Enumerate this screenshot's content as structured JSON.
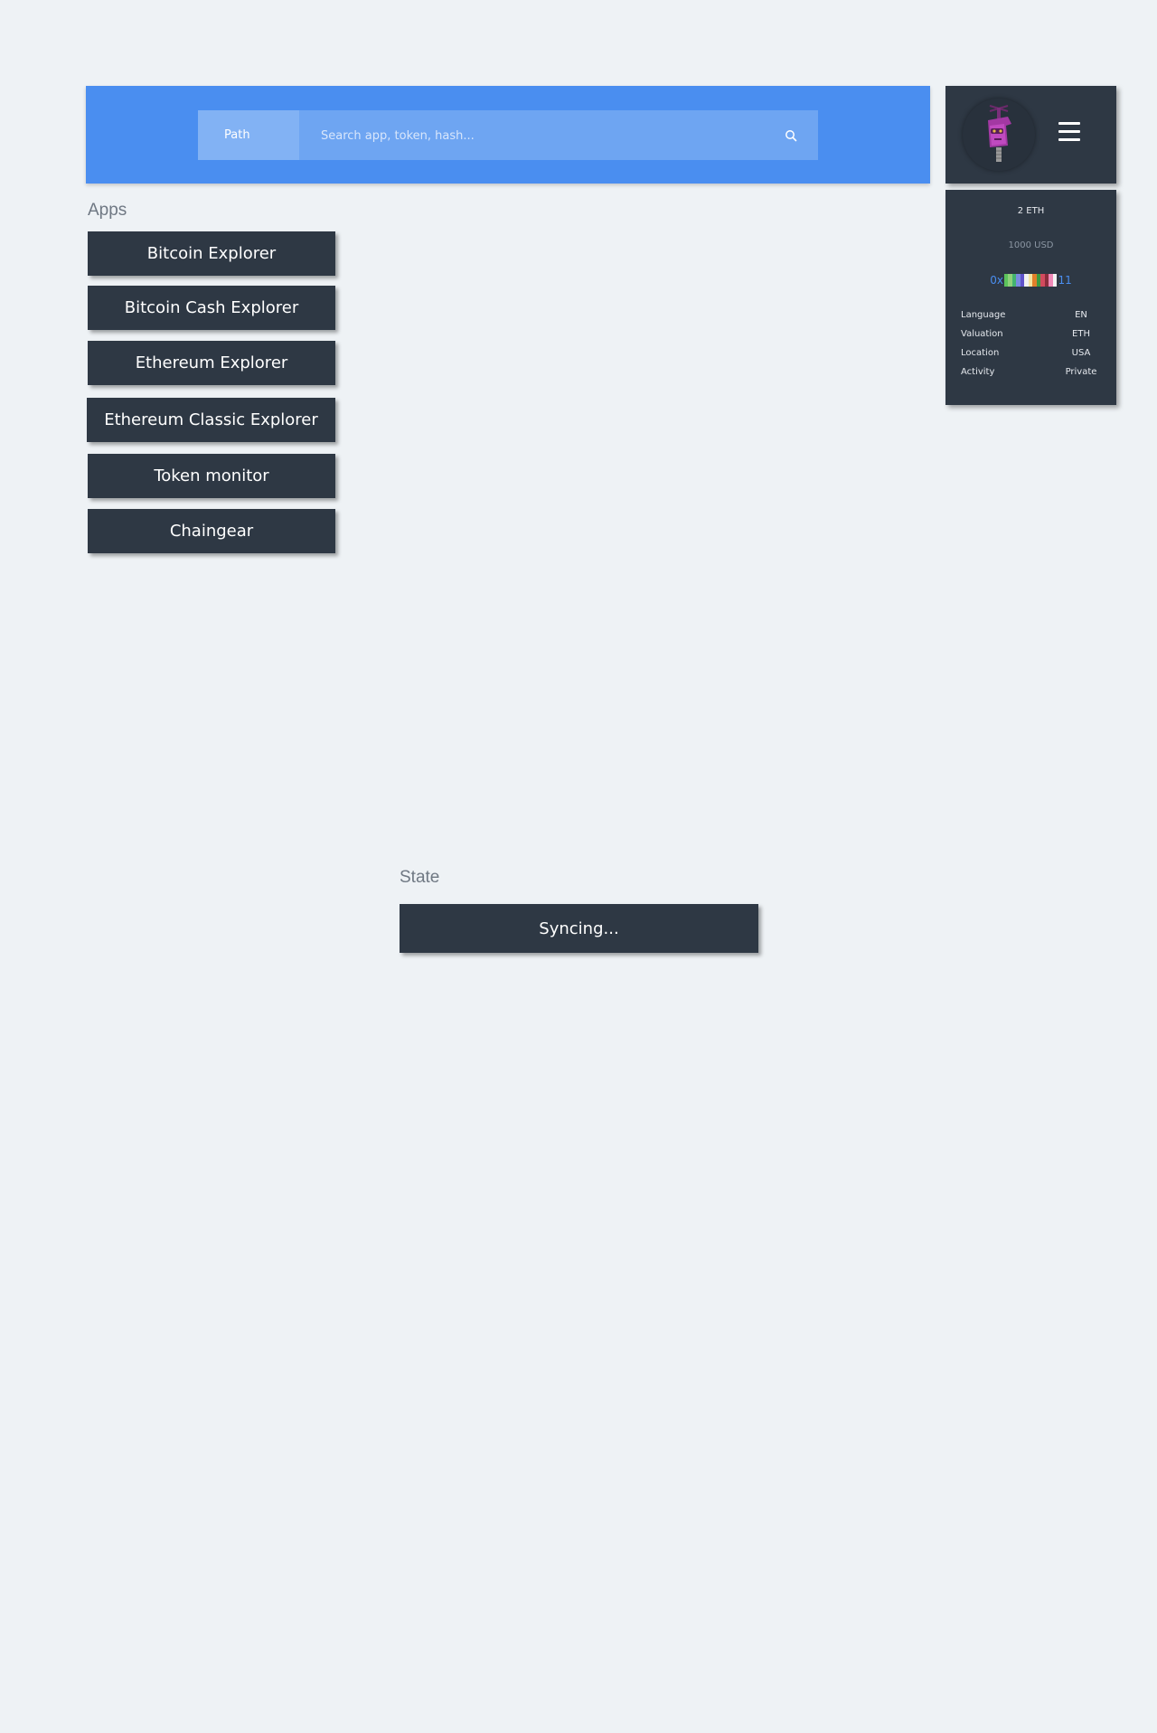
{
  "search": {
    "path_label": "Path",
    "placeholder": "Search app, token, hash..."
  },
  "user": {
    "avatar_icon": "robot-avatar-icon",
    "menu_icon": "hamburger-menu-icon"
  },
  "wallet": {
    "balance_eth": "2 ETH",
    "balance_usd": "1000 USD",
    "address_prefix": "0x",
    "address_suffix": "11",
    "address_colors": [
      "#5cc25b",
      "#8fd17a",
      "#43b36f",
      "#7a8ae0",
      "#5f52c9",
      "#f1f1f1",
      "#f5e6a0",
      "#e2802a",
      "#3e9a3e",
      "#d24a5e",
      "#8a2c3c",
      "#f08ab8",
      "#f4f4f4"
    ],
    "settings": [
      {
        "label": "Language",
        "value": "EN"
      },
      {
        "label": "Valuation",
        "value": "ETH"
      },
      {
        "label": "Location",
        "value": "USA"
      },
      {
        "label": "Activity",
        "value": "Private"
      }
    ]
  },
  "apps": {
    "label": "Apps",
    "items": [
      "Bitcoin Explorer",
      "Bitcoin Cash Explorer",
      "Ethereum Explorer",
      "Ethereum Classic Explorer",
      "Token monitor",
      "Chaingear"
    ]
  },
  "state": {
    "label": "State",
    "status": "Syncing..."
  },
  "colors": {
    "accent": "#4a8ef0",
    "panel": "#2e3844",
    "background": "#eef2f5"
  }
}
